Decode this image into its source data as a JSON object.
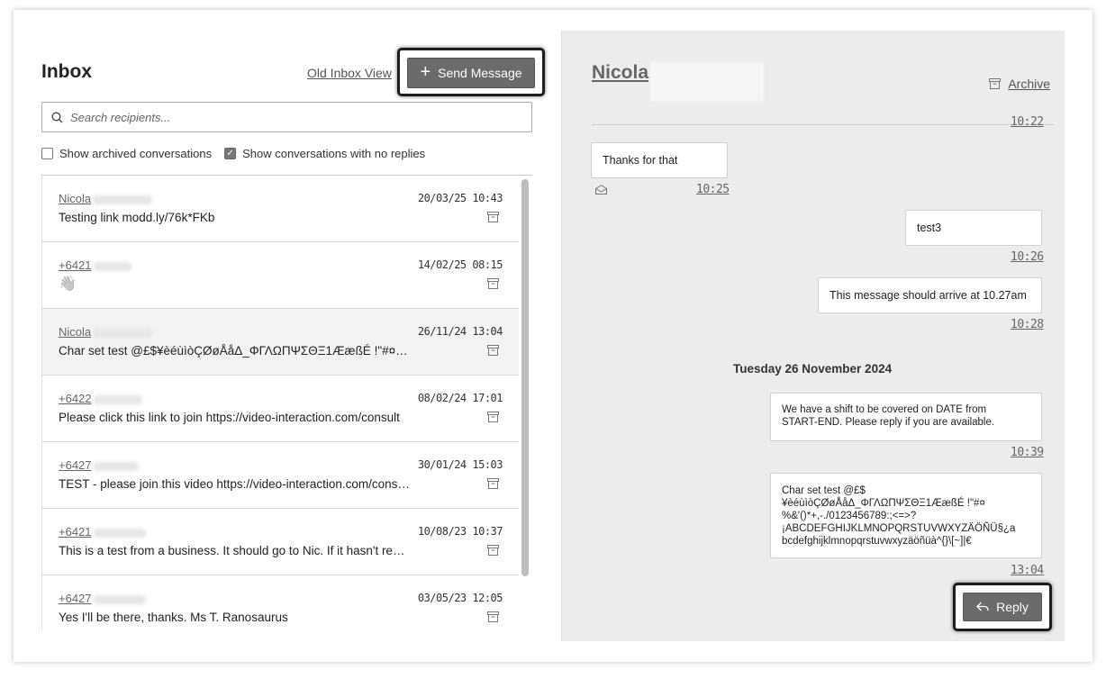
{
  "inbox": {
    "title": "Inbox",
    "old_view_label": "Old Inbox View",
    "send_label": "Send Message",
    "search_placeholder": "Search recipients...",
    "filter_archived": "Show archived conversations",
    "filter_archived_checked": false,
    "filter_noreplies": "Show conversations with no replies",
    "filter_noreplies_checked": true,
    "conversations": [
      {
        "name": "Nicola",
        "date": "20/03/25 10:43",
        "message": "Testing link modd.ly/76k*FKb"
      },
      {
        "name": "+6421",
        "date": "14/02/25 08:15",
        "message": "👋"
      },
      {
        "name": "Nicola",
        "date": "26/11/24 13:04",
        "message": "Char set test @£$¥èéùìòÇØøÅåΔ_ΦΓΛΩΠΨΣΘΞ1ÆæßÉ !\"#¤%&'()*+,-./0123456789:;<=>?¡ABCDEFGHIJKLMNOPQRSTUVWXYZÄÖÑÜ§¿abcdefghijklmnopqrstuvwxyzäöñüà^{}\\[~]|€"
      },
      {
        "name": "+6422",
        "date": "08/02/24 17:01",
        "message": "Please click this link to join https://video-interaction.com/consult"
      },
      {
        "name": "+6427",
        "date": "30/01/24 15:03",
        "message": "TEST - please join this video https://video-interaction.com/consult"
      },
      {
        "name": "+6421",
        "date": "10/08/23 10:37",
        "message": "This is a test from a business. It should go to Nic. If it hasn't reached you"
      },
      {
        "name": "+6427",
        "date": "03/05/23 12:05",
        "message": "Yes I'll be there, thanks. Ms T. Ranosaurus"
      }
    ]
  },
  "thread": {
    "contact": "Nicola",
    "archive_label": "Archive",
    "reply_label": "Reply",
    "day_separator": "Tuesday 26 November 2024",
    "messages": [
      {
        "time": "10:22"
      },
      {
        "text": "Thanks for that",
        "time": "10:25"
      },
      {
        "text": "test3",
        "time": "10:26"
      },
      {
        "text": "This message should arrive at 10.27am",
        "time": "10:28"
      },
      {
        "text": "We have a shift to be covered on DATE from\nSTART-END. Please reply if you are available.",
        "time": "10:39"
      },
      {
        "text": "Char set test @£$\n¥èéùìòÇØøÅåΔ_ΦΓΛΩΠΨΣΘΞ1ÆæßÉ !\"#¤\n%&'()*+,-./0123456789:;<=>?\n¡ABCDEFGHIJKLMNOPQRSTUVWXYZÄÖÑÜ§¿a\nbcdefghijklmnopqrstuvwxyzäöñüà^{}\\[~]|€",
        "time": "13:04"
      }
    ]
  },
  "icons": {
    "search": "search-icon",
    "archive": "archive-icon",
    "plus": "plus-icon",
    "reply": "reply-icon",
    "envelope": "envelope-open-icon",
    "check": "check-icon"
  },
  "colors": {
    "button": "#6b6b6b",
    "thread_bg": "#ececec",
    "selected_row": "#f3f3f3"
  }
}
